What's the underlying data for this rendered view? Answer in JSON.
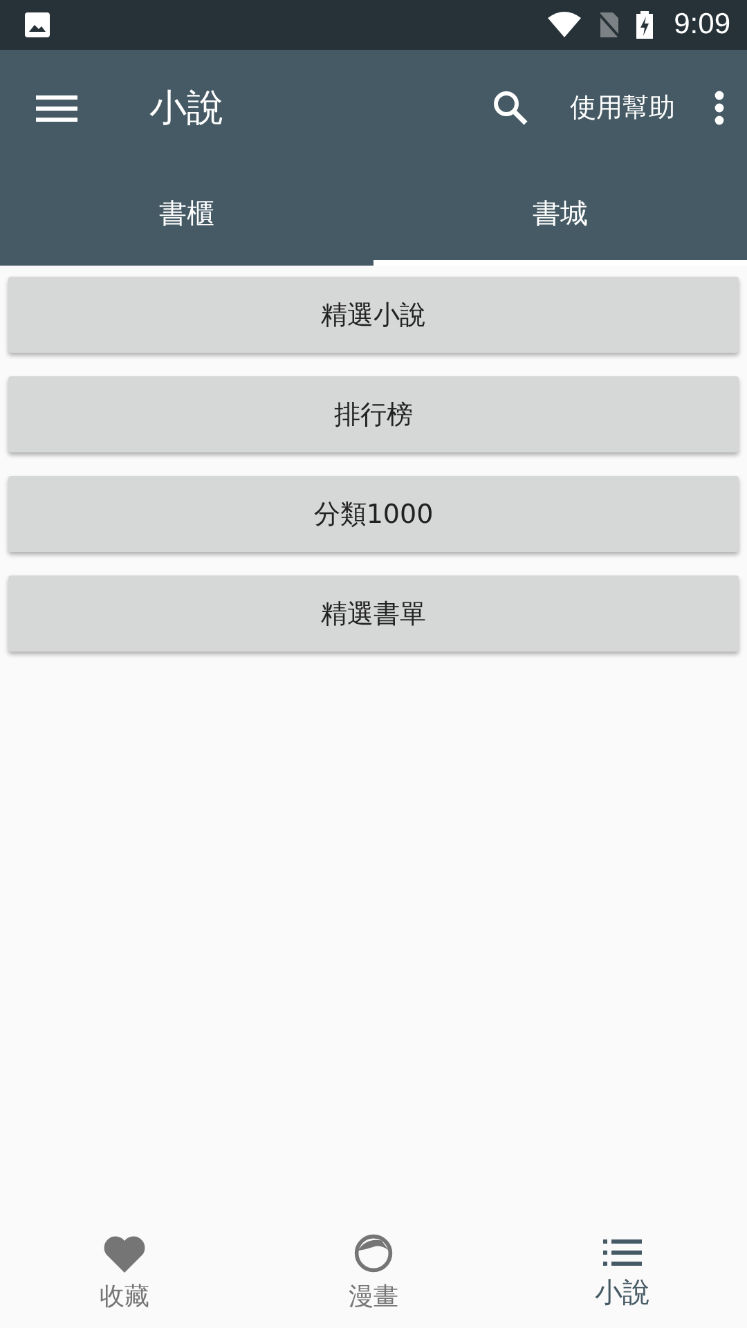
{
  "status_bar": {
    "time": "9:09"
  },
  "app_bar": {
    "title": "小說",
    "action": "使用幫助"
  },
  "tabs": [
    {
      "label": "書櫃",
      "selected": false
    },
    {
      "label": "書城",
      "selected": true
    }
  ],
  "buttons": [
    "精選小說",
    "排行榜",
    "分類1000",
    "精選書單"
  ],
  "bottom_nav": [
    {
      "label": "收藏",
      "kind": "heart",
      "selected": false
    },
    {
      "label": "漫畫",
      "kind": "face",
      "selected": false
    },
    {
      "label": "小說",
      "kind": "list",
      "selected": true
    }
  ]
}
